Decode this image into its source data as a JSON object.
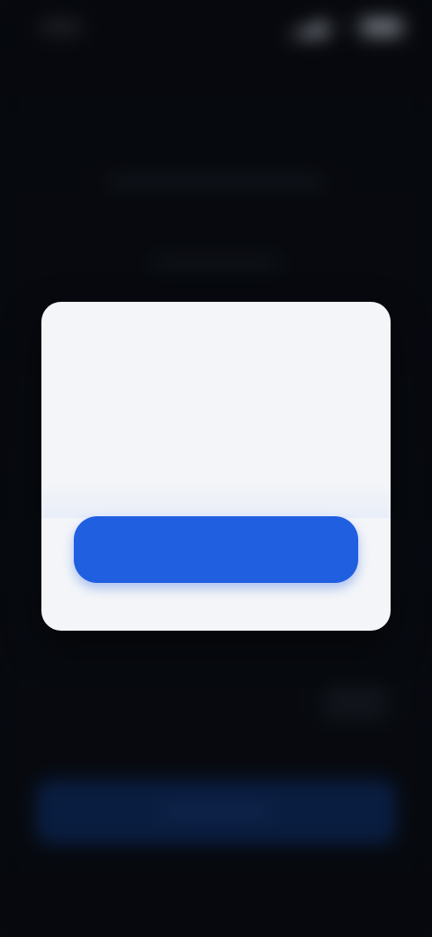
{
  "status_bar": {
    "time": "",
    "icons": [
      "wifi-icon",
      "signal-icon",
      "battery-icon"
    ]
  },
  "background": {
    "heading": "",
    "cta_label": ""
  },
  "dialog": {
    "title": "",
    "body": "",
    "primary_button": "",
    "secondary_action": ""
  },
  "colors": {
    "accent": "#1f5fe0",
    "dialog_bg": "#f3f5f8",
    "scrim": "#0b0f17"
  }
}
